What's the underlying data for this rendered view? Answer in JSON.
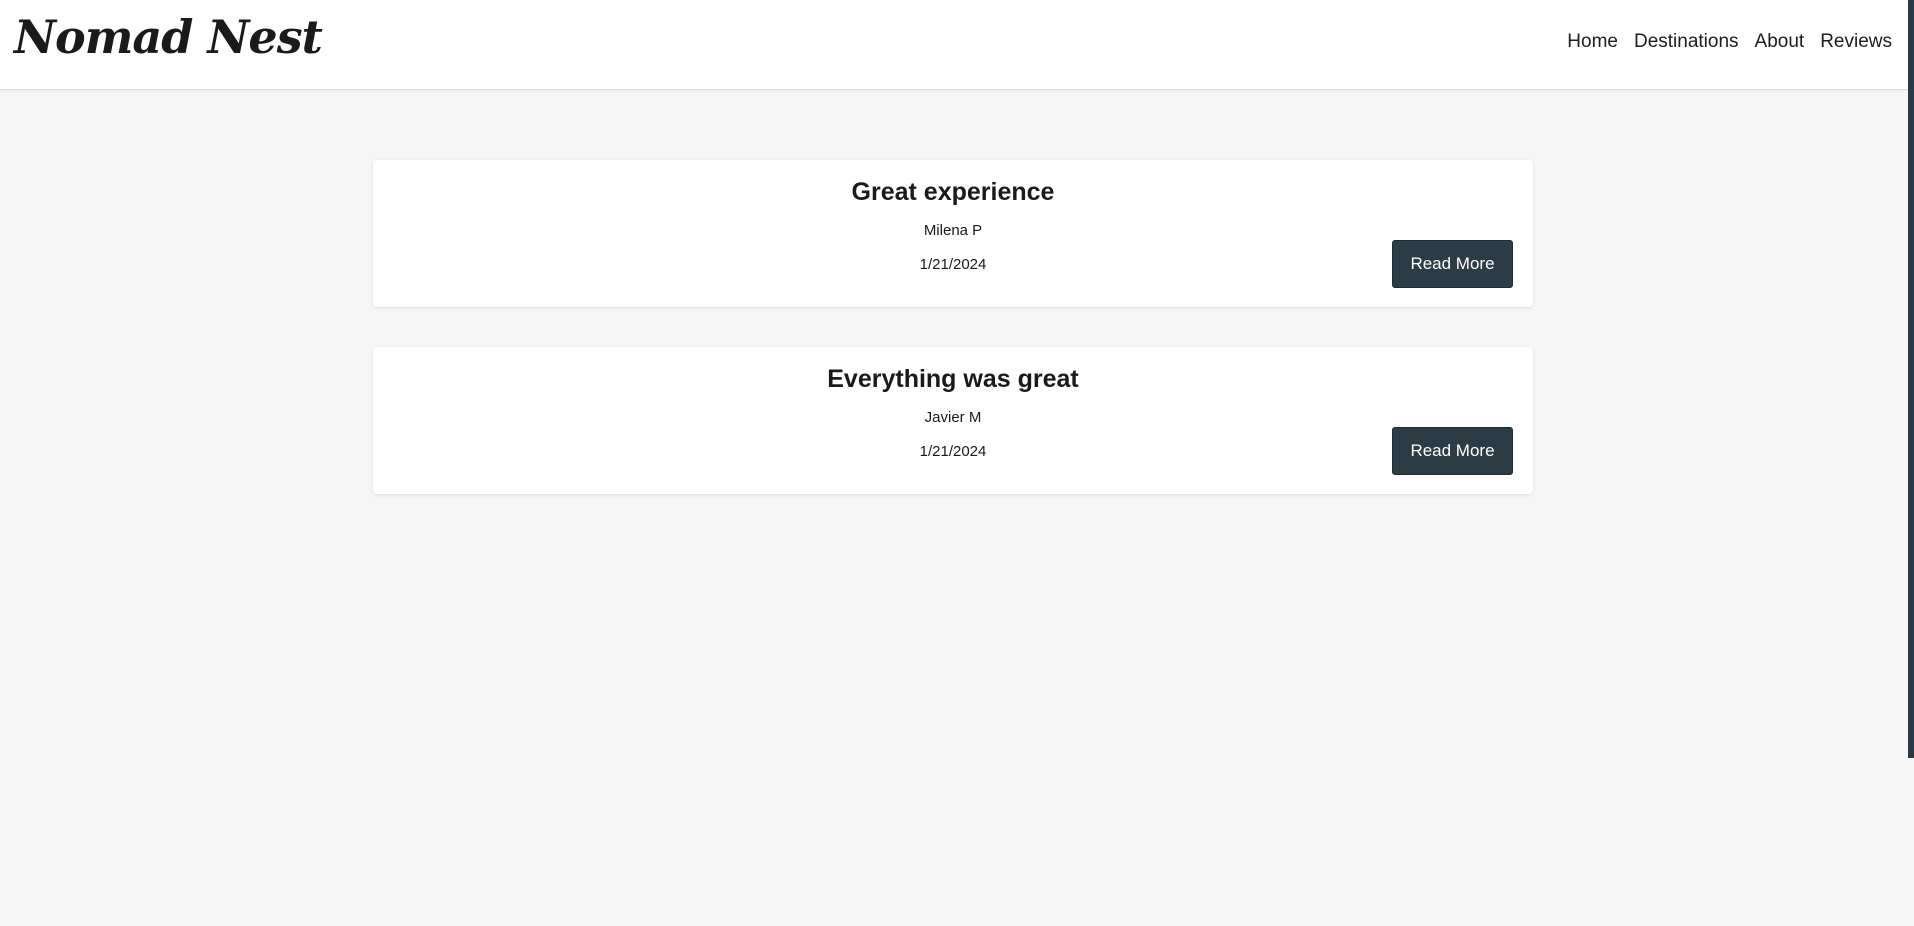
{
  "header": {
    "brand": "Nomad Nest",
    "nav": [
      {
        "label": "Home"
      },
      {
        "label": "Destinations"
      },
      {
        "label": "About"
      },
      {
        "label": "Reviews"
      }
    ]
  },
  "reviews": [
    {
      "title": "Great experience",
      "author": "Milena P",
      "date": "1/21/2024",
      "button_label": "Read More"
    },
    {
      "title": "Everything was great",
      "author": "Javier M",
      "date": "1/21/2024",
      "button_label": "Read More"
    }
  ],
  "colors": {
    "page_background": "#f6f6f6",
    "card_background": "#ffffff",
    "button_background": "#2c3c44",
    "button_text": "#ffffff"
  }
}
